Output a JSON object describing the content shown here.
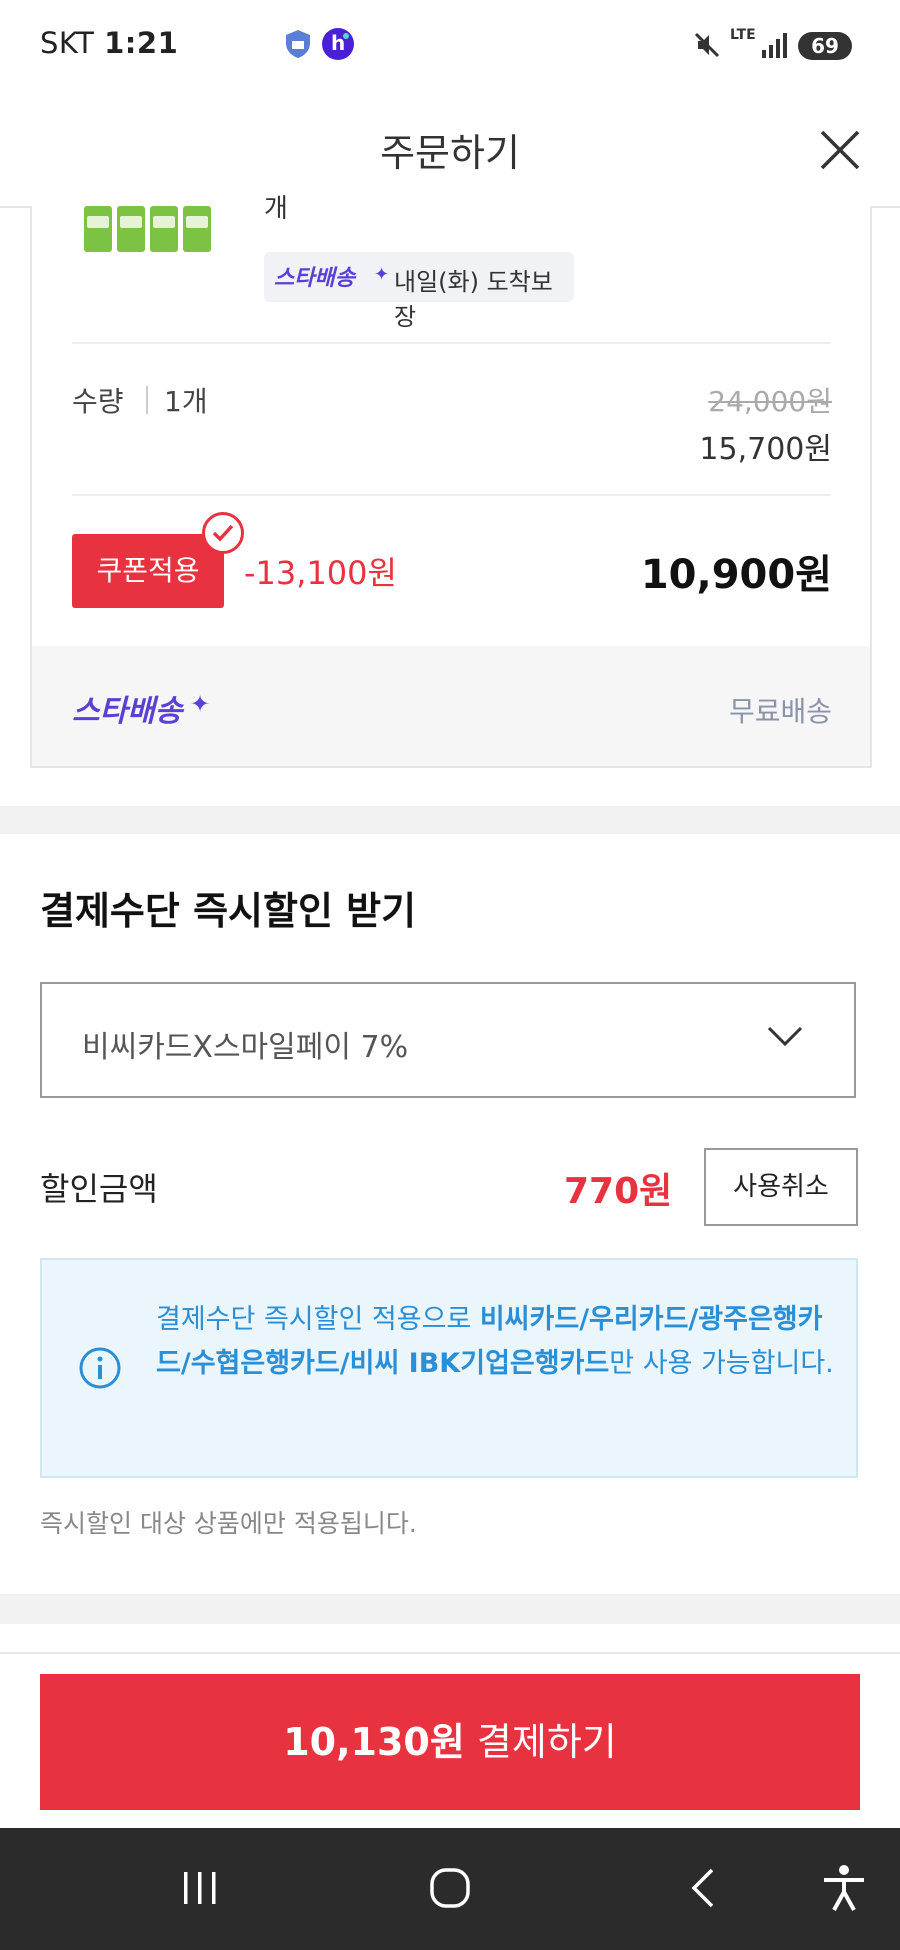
{
  "status_bar": {
    "carrier": "SKT",
    "time": "1:21",
    "network": "LTE",
    "battery": "69"
  },
  "header": {
    "title": "주문하기"
  },
  "product": {
    "name_partial": "개",
    "delivery_badge": "스타배송",
    "delivery_promise": "내일(화) 도착보장",
    "quantity_label": "수량",
    "quantity_value": "1개",
    "original_price": "24,000원",
    "sale_price": "15,700원",
    "coupon_label": "쿠폰적용",
    "coupon_discount": "-13,100원",
    "final_price": "10,900원",
    "shipping_brand": "스타배송",
    "shipping_fee": "무료배송"
  },
  "payment_discount": {
    "title": "결제수단 즉시할인 받기",
    "selected_option": "비씨카드X스마일페이 7%",
    "discount_label": "할인금액",
    "discount_value": "770원",
    "cancel_label": "사용취소",
    "info_prefix": "결제수단 즉시할인 적용으로 ",
    "info_cards": "비씨카드/우리카드/광주은행카드/수협은행카드/비씨 IBK기업은행카드",
    "info_suffix": "만 사용 가능합니다.",
    "note": "즉시할인 대상 상품에만 적용됩니다."
  },
  "pay_button": {
    "amount": "10,130원",
    "label": " 결제하기"
  },
  "colors": {
    "accent_red": "#e8323f",
    "info_blue": "#2a8fd6",
    "star_purple": "#5b3fd6"
  }
}
